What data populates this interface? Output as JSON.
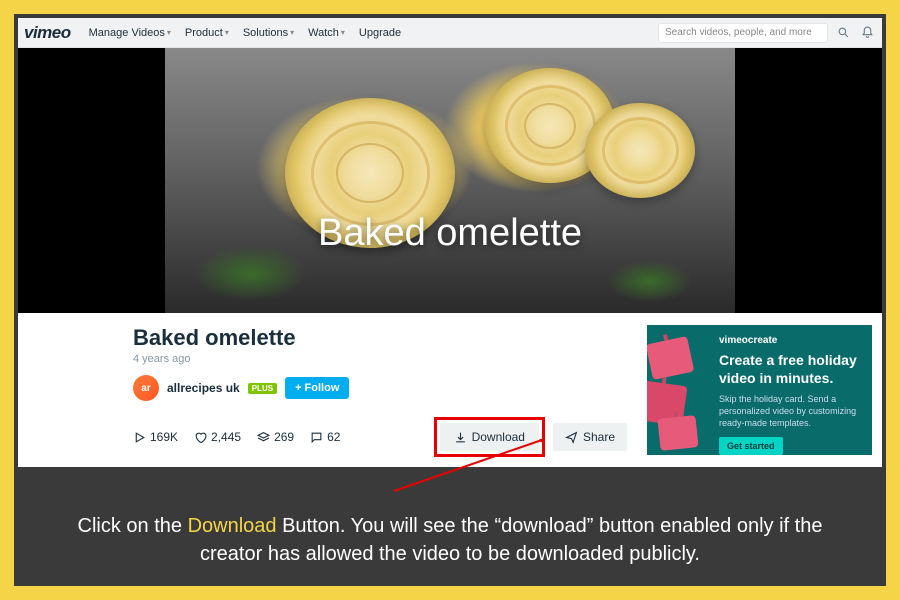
{
  "nav": {
    "logo": "vimeo",
    "items": [
      "Manage Videos",
      "Product",
      "Solutions",
      "Watch"
    ],
    "upgrade": "Upgrade",
    "search_placeholder": "Search videos, people, and more"
  },
  "video": {
    "overlay_title": "Baked omelette",
    "title": "Baked omelette",
    "age": "4 years ago"
  },
  "channel": {
    "avatar_initials": "ar",
    "name": "allrecipes uk",
    "badge": "PLUS",
    "follow_label": "+ Follow"
  },
  "stats": {
    "plays": "169K",
    "likes": "2,445",
    "collections": "269",
    "comments": "62"
  },
  "actions": {
    "download": "Download",
    "share": "Share"
  },
  "promo": {
    "brand": "vimeocreate",
    "headline": "Create a free holiday video in minutes.",
    "body": "Skip the holiday card. Send a personalized video by customizing ready-made templates.",
    "cta": "Get started"
  },
  "caption": {
    "pre": "Click on the ",
    "hl": "Download",
    "post": " Button. You will see the “download” button enabled only if the creator has allowed the video to be downloaded publicly."
  }
}
